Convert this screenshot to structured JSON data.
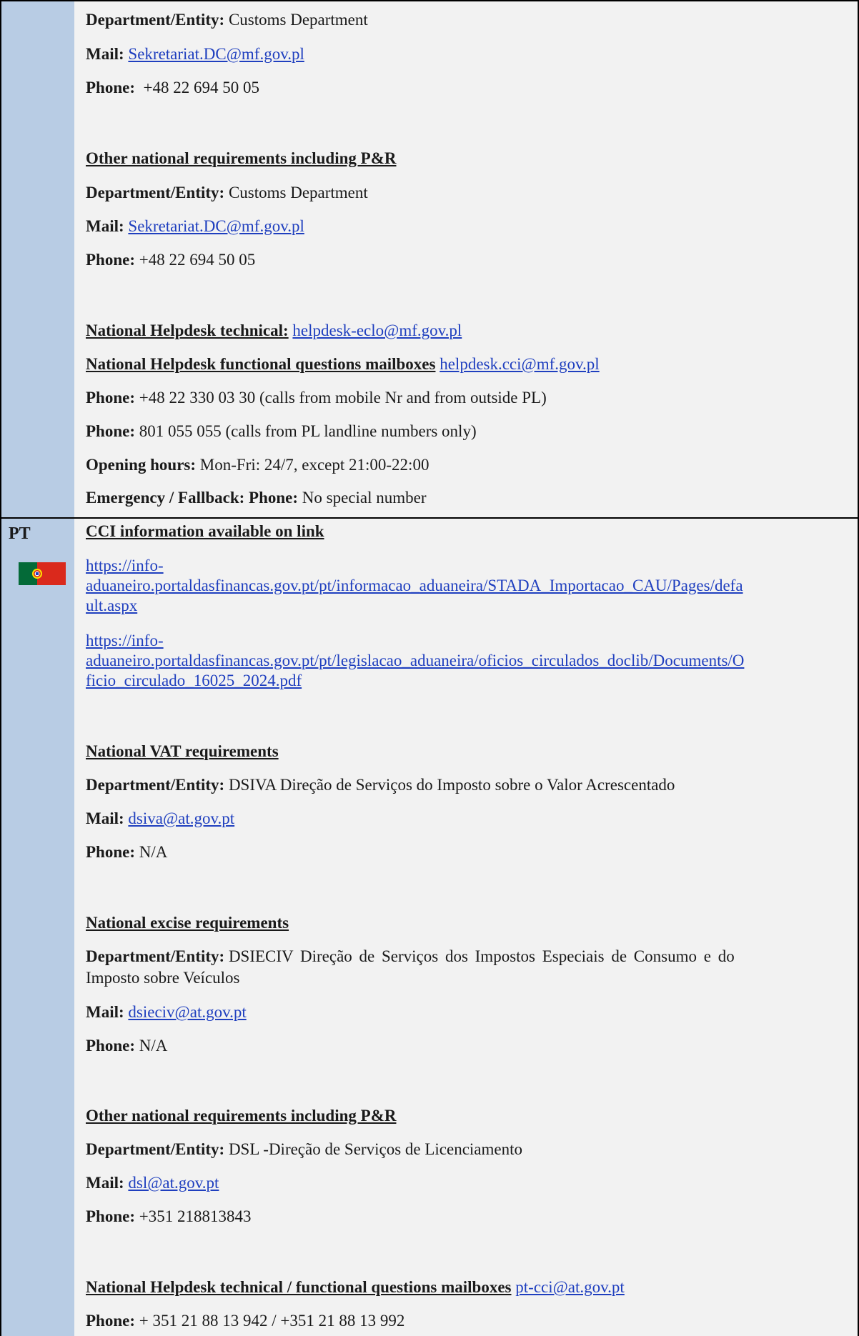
{
  "pl": {
    "block1": {
      "dept_label": "Department/Entity:",
      "dept_value": "Customs Department",
      "mail_label": "Mail:",
      "mail_value": "Sekretariat.DC@mf.gov.pl",
      "phone_label": "Phone:",
      "phone_value": " +48 22 694 50 05"
    },
    "block2": {
      "header": "Other national requirements including P&R",
      "dept_label": "Department/Entity:",
      "dept_value": "Customs Department",
      "mail_label": "Mail:",
      "mail_value": "Sekretariat.DC@mf.gov.pl",
      "phone_label": "Phone:",
      "phone_value": "+48 22 694 50 05"
    },
    "helpdesk": {
      "technical_label": "National Helpdesk technical:",
      "technical_mail": "helpdesk-eclo@mf.gov.pl",
      "functional_label": "National Helpdesk functional questions mailboxes",
      "functional_mail": "helpdesk.cci@mf.gov.pl",
      "phone1_label": "Phone:",
      "phone1_value": "+48 22 330 03 30 (calls from mobile Nr and from outside PL)",
      "phone2_label": "Phone:",
      "phone2_value": "801 055 055 (calls from PL landline numbers only)",
      "hours_label": "Opening hours:",
      "hours_value": "Mon-Fri: 24/7, except 21:00-22:00",
      "emergency_label": "Emergency / Fallback: Phone:",
      "emergency_value": "No special number"
    }
  },
  "pt": {
    "code": "PT",
    "flag_icon": "portugal-flag-icon",
    "cci_header": "CCI information available on link",
    "link1_a": "https://info-",
    "link1_b": "aduaneiro.portaldasfinancas.gov.pt/pt/informacao_aduaneira/STADA_Importacao_CAU/Pages/defa",
    "link1_c": "ult.aspx",
    "link2_a": "https://info-",
    "link2_b": "aduaneiro.portaldasfinancas.gov.pt/pt/legislacao_aduaneira/oficios_circulados_doclib/Documents/O",
    "link2_c": "ficio_circulado_16025_2024.pdf",
    "vat": {
      "header": "National VAT requirements",
      "dept_label": "Department/Entity:",
      "dept_value": "DSIVA Direção de Serviços do Imposto sobre o Valor Acrescentado",
      "mail_label": "Mail:",
      "mail_value": "dsiva@at.gov.pt",
      "phone_label": "Phone:",
      "phone_value": "N/A"
    },
    "excise": {
      "header": "National excise requirements",
      "dept_label": "Department/Entity:",
      "dept_value_1": "DSIECIV Direção de Serviços dos Impostos Especiais de Consumo e do",
      "dept_value_2": "Imposto sobre Veículos",
      "mail_label": "Mail:",
      "mail_value": "dsieciv@at.gov.pt",
      "phone_label": "Phone:",
      "phone_value": "N/A"
    },
    "other": {
      "header": "Other national requirements including P&R",
      "dept_label": "Department/Entity:",
      "dept_value": "DSL -Direção de Serviços de Licenciamento",
      "mail_label": "Mail:",
      "mail_value": "dsl@at.gov.pt",
      "phone_label": "Phone:",
      "phone_value": "+351 218813843"
    },
    "helpdesk": {
      "label": "National Helpdesk technical / functional questions mailboxes",
      "mail": "pt-cci@at.gov.pt",
      "phone_label": "Phone:",
      "phone_value": "+ 351 21 88 13 942 / +351 21 88 13 992"
    },
    "colors": {
      "green": "#046a38",
      "red": "#da291c",
      "gold": "#ffe100"
    }
  }
}
